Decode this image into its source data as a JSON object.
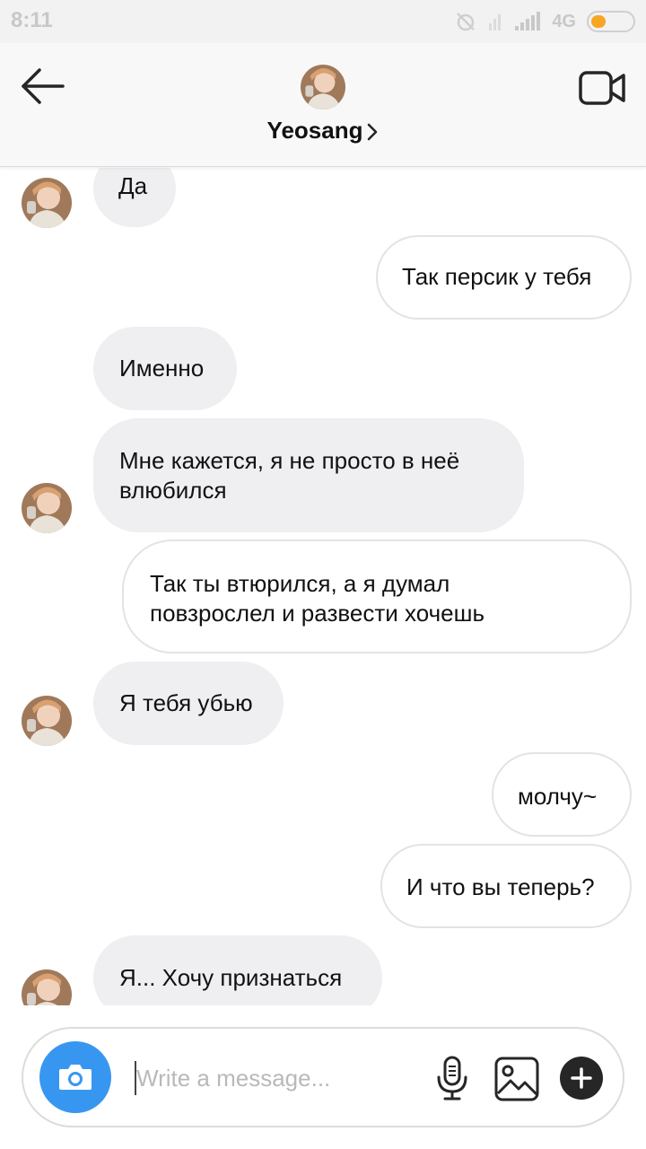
{
  "status_bar": {
    "time": "8:11",
    "network": "4G"
  },
  "header": {
    "contact_name": "Yeosang",
    "icons": {
      "back": "arrow-left-icon",
      "video": "video-call-icon",
      "chevron": "chevron-right-icon"
    }
  },
  "messages": [
    {
      "side": "in",
      "text": "Да"
    },
    {
      "side": "out",
      "text": "Так персик у тебя"
    },
    {
      "side": "in",
      "text": "Именно"
    },
    {
      "side": "in",
      "text": "Мне кажется, я не просто в неё\nвлюбился"
    },
    {
      "side": "out",
      "text": "Так ты втюрился, а я думал\nповзрослел и развести хочешь"
    },
    {
      "side": "in",
      "text": "Я тебя убью"
    },
    {
      "side": "out",
      "text": "молчу~"
    },
    {
      "side": "out",
      "text": "И что вы теперь?"
    },
    {
      "side": "in",
      "text": "Я... Хочу признаться"
    }
  ],
  "composer": {
    "placeholder": "Write a message...",
    "icons": {
      "camera": "camera-icon",
      "mic": "microphone-icon",
      "gallery": "gallery-icon",
      "add": "plus-icon"
    }
  },
  "colors": {
    "accent": "#3797f0",
    "incoming_bubble": "#efeef1",
    "outgoing_border": "#e3e3e6",
    "battery": "#f6a623"
  }
}
